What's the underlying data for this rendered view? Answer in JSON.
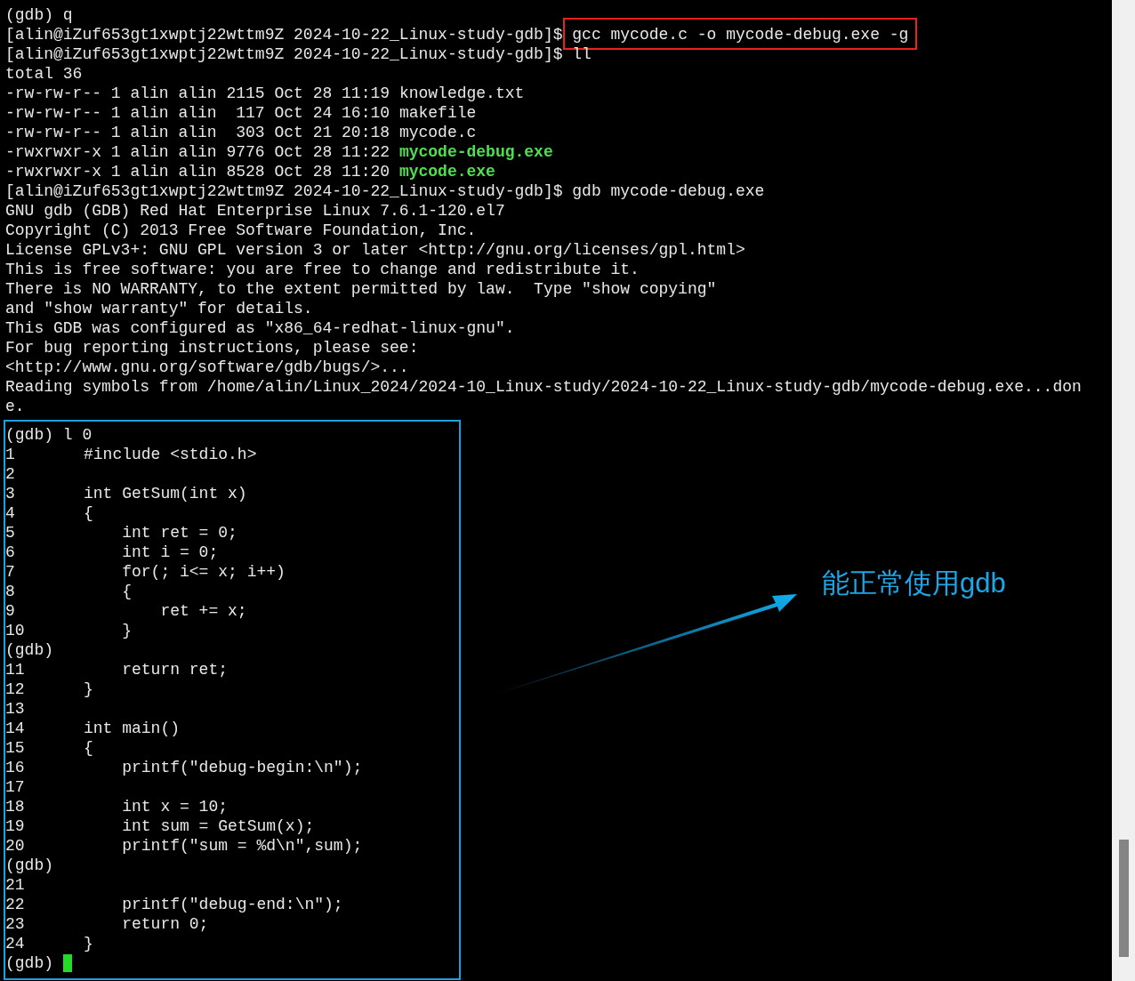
{
  "terminal": {
    "lines": [
      {
        "kind": "text",
        "text": "(gdb) q"
      },
      {
        "kind": "prompt",
        "prompt": "[alin@iZuf653gt1xwptj22wttm9Z 2024-10-22_Linux-study-gdb]$ ",
        "command": "gcc mycode.c -o mycode-debug.exe -g",
        "boxed": true
      },
      {
        "kind": "prompt",
        "prompt": "[alin@iZuf653gt1xwptj22wttm9Z 2024-10-22_Linux-study-gdb]$ ",
        "command": "ll",
        "boxed": false
      },
      {
        "kind": "text",
        "text": "total 36"
      },
      {
        "kind": "listing",
        "meta": "-rw-rw-r-- 1 alin alin 2115 Oct 28 11:19 ",
        "name": "knowledge.txt",
        "executable": false
      },
      {
        "kind": "listing",
        "meta": "-rw-rw-r-- 1 alin alin  117 Oct 24 16:10 ",
        "name": "makefile",
        "executable": false
      },
      {
        "kind": "listing",
        "meta": "-rw-rw-r-- 1 alin alin  303 Oct 21 20:18 ",
        "name": "mycode.c",
        "executable": false
      },
      {
        "kind": "listing",
        "meta": "-rwxrwxr-x 1 alin alin 9776 Oct 28 11:22 ",
        "name": "mycode-debug.exe",
        "executable": true
      },
      {
        "kind": "listing",
        "meta": "-rwxrwxr-x 1 alin alin 8528 Oct 28 11:20 ",
        "name": "mycode.exe",
        "executable": true
      },
      {
        "kind": "prompt",
        "prompt": "[alin@iZuf653gt1xwptj22wttm9Z 2024-10-22_Linux-study-gdb]$ ",
        "command": "gdb mycode-debug.exe",
        "boxed": false
      },
      {
        "kind": "text",
        "text": "GNU gdb (GDB) Red Hat Enterprise Linux 7.6.1-120.el7"
      },
      {
        "kind": "text",
        "text": "Copyright (C) 2013 Free Software Foundation, Inc."
      },
      {
        "kind": "text",
        "text": "License GPLv3+: GNU GPL version 3 or later <http://gnu.org/licenses/gpl.html>"
      },
      {
        "kind": "text",
        "text": "This is free software: you are free to change and redistribute it."
      },
      {
        "kind": "text",
        "text": "There is NO WARRANTY, to the extent permitted by law.  Type \"show copying\""
      },
      {
        "kind": "text",
        "text": "and \"show warranty\" for details."
      },
      {
        "kind": "text",
        "text": "This GDB was configured as \"x86_64-redhat-linux-gnu\"."
      },
      {
        "kind": "text",
        "text": "For bug reporting instructions, please see:"
      },
      {
        "kind": "text",
        "text": "<http://www.gnu.org/software/gdb/bugs/>..."
      },
      {
        "kind": "text",
        "text": "Reading symbols from /home/alin/Linux_2024/2024-10_Linux-study/2024-10-22_Linux-study-gdb/mycode-debug.exe...don"
      },
      {
        "kind": "text",
        "text": "e."
      }
    ],
    "highlighted_block": {
      "lines": [
        {
          "kind": "text",
          "text": "(gdb) l 0"
        },
        {
          "kind": "code",
          "number": "1",
          "code": "#include <stdio.h>"
        },
        {
          "kind": "code",
          "number": "2"
        },
        {
          "kind": "code",
          "number": "3",
          "code": "int GetSum(int x)"
        },
        {
          "kind": "code",
          "number": "4",
          "code": "{"
        },
        {
          "kind": "code",
          "number": "5",
          "code": "    int ret = 0;"
        },
        {
          "kind": "code",
          "number": "6",
          "code": "    int i = 0;"
        },
        {
          "kind": "code",
          "number": "7",
          "code": "    for(; i<= x; i++)"
        },
        {
          "kind": "code",
          "number": "8",
          "code": "    {"
        },
        {
          "kind": "code",
          "number": "9",
          "code": "        ret += x;"
        },
        {
          "kind": "code",
          "number": "10",
          "code": "    }"
        },
        {
          "kind": "text",
          "text": "(gdb)"
        },
        {
          "kind": "code",
          "number": "11",
          "code": "    return ret;"
        },
        {
          "kind": "code",
          "number": "12",
          "code": "}"
        },
        {
          "kind": "code",
          "number": "13"
        },
        {
          "kind": "code",
          "number": "14",
          "code": "int main()"
        },
        {
          "kind": "code",
          "number": "15",
          "code": "{"
        },
        {
          "kind": "code",
          "number": "16",
          "code": "    printf(\"debug-begin:\\n\");"
        },
        {
          "kind": "code",
          "number": "17"
        },
        {
          "kind": "code",
          "number": "18",
          "code": "    int x = 10;"
        },
        {
          "kind": "code",
          "number": "19",
          "code": "    int sum = GetSum(x);"
        },
        {
          "kind": "code",
          "number": "20",
          "code": "    printf(\"sum = %d\\n\",sum);"
        },
        {
          "kind": "text",
          "text": "(gdb)"
        },
        {
          "kind": "code",
          "number": "21"
        },
        {
          "kind": "code",
          "number": "22",
          "code": "    printf(\"debug-end:\\n\");"
        },
        {
          "kind": "code",
          "number": "23",
          "code": "    return 0;"
        },
        {
          "kind": "code",
          "number": "24",
          "code": "}"
        },
        {
          "kind": "cursor",
          "text": "(gdb) "
        }
      ]
    }
  },
  "annotation": {
    "text": "能正常使用gdb"
  }
}
